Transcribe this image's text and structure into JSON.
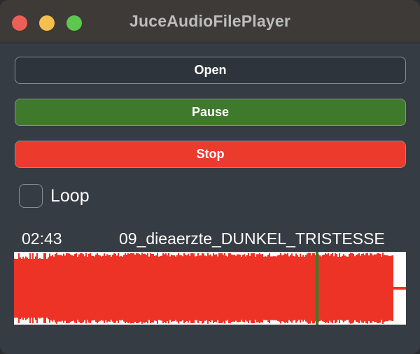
{
  "window": {
    "title": "JuceAudioFilePlayer"
  },
  "buttons": {
    "open_label": "Open",
    "pause_label": "Pause",
    "stop_label": "Stop"
  },
  "loop": {
    "label": "Loop",
    "checked": false
  },
  "player": {
    "time": "02:43",
    "filename": "09_dieaerzte_DUNKEL_TRISTESSE",
    "playhead_fraction": 0.77
  },
  "colors": {
    "waveform": "#ec3326",
    "playhead": "#3d7a28",
    "open_button": "#2e343b",
    "pause_button": "#3f7a2c",
    "stop_button": "#ec3a2d"
  }
}
